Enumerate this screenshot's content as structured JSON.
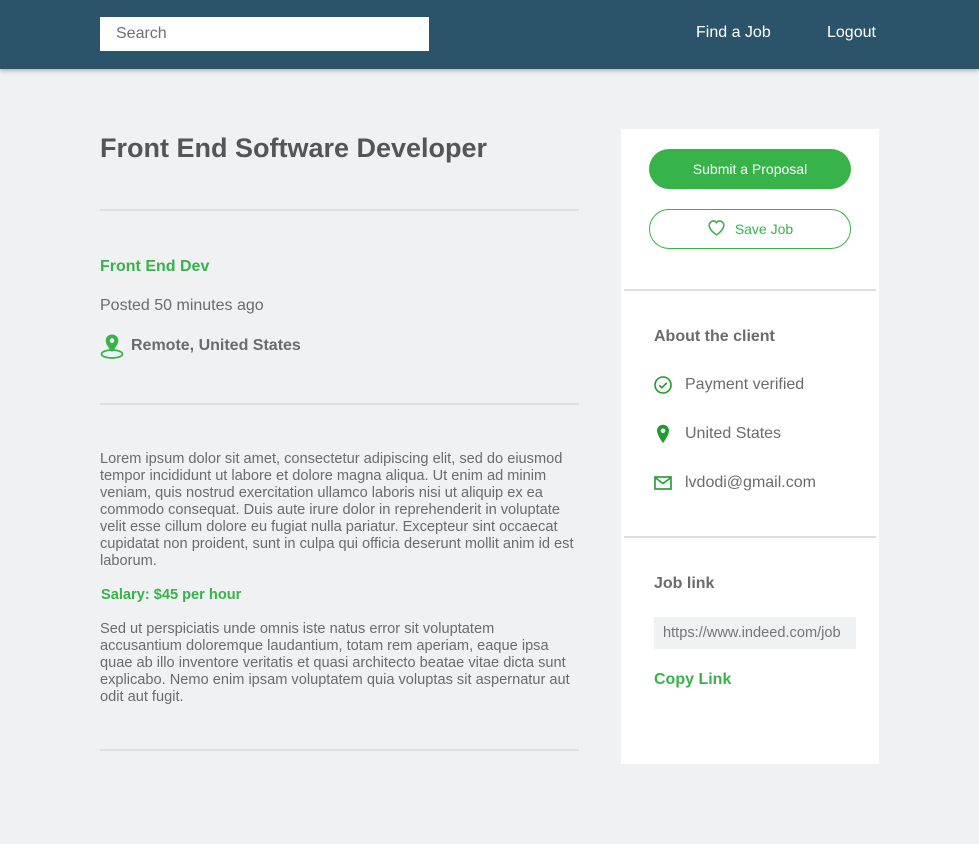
{
  "header": {
    "search_placeholder": "Search",
    "nav_find_job": "Find a Job",
    "nav_logout": "Logout"
  },
  "job": {
    "title": "Front End Software Developer",
    "category": "Front End Dev",
    "posted": "Posted 50 minutes ago",
    "location": "Remote, United States",
    "description_1": "Lorem ipsum dolor sit amet, consectetur adipiscing elit, sed do eiusmod tempor incididunt ut labore et dolore magna aliqua. Ut enim ad minim veniam, quis nostrud exercitation ullamco laboris nisi ut aliquip ex ea commodo consequat. Duis aute irure dolor in reprehenderit in voluptate velit esse cillum dolore eu fugiat nulla pariatur. Excepteur sint occaecat cupidatat non proident, sunt in culpa qui officia deserunt mollit anim id est laborum.",
    "salary": "Salary: $45 per hour",
    "description_2": "Sed ut perspiciatis unde omnis iste natus error sit voluptatem accusantium doloremque laudantium, totam rem aperiam, eaque ipsa quae ab illo inventore veritatis et quasi architecto beatae vitae dicta sunt explicabo. Nemo enim ipsam voluptatem quia voluptas sit aspernatur aut odit aut fugit."
  },
  "sidebar": {
    "submit_label": "Submit a Proposal",
    "save_label": "Save Job",
    "about_heading": "About the client",
    "payment": "Payment verified",
    "country": "United States",
    "email": "lvdodi@gmail.com",
    "job_link_heading": "Job link",
    "job_link_placeholder": "https://www.indeed.com/job",
    "copy_label": "Copy Link"
  },
  "icons": {
    "location": "map-pin-icon",
    "heart": "heart-icon",
    "verified": "check-circle-icon",
    "pin": "pin-icon",
    "mail": "mail-icon"
  },
  "colors": {
    "navbar": "#2b546a",
    "accent": "#37b34a",
    "background": "#f0f1f3",
    "text": "#6b6b6b"
  }
}
